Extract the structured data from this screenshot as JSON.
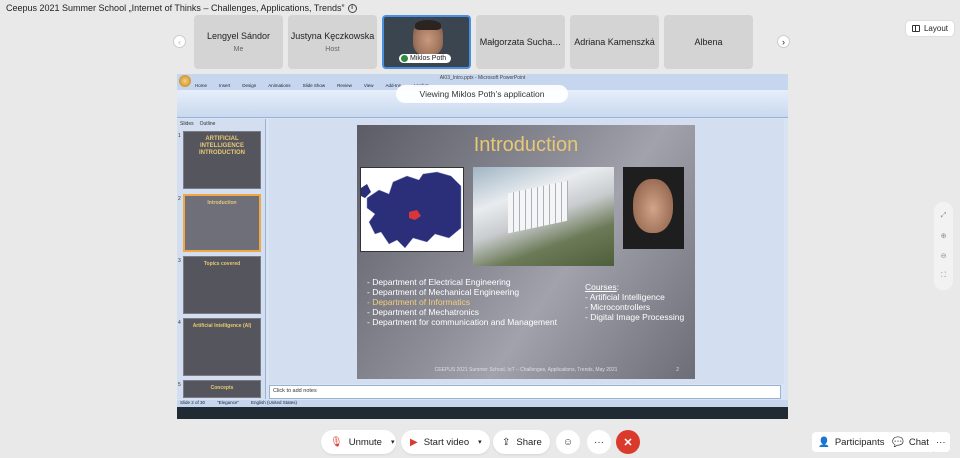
{
  "meeting": {
    "title": "Ceepus 2021 Summer School „Internet of Thinks – Challenges, Applications, Trends”",
    "layout_label": "Layout"
  },
  "participants": [
    {
      "name": "Lengyel Sándor",
      "role": "Me",
      "video": false
    },
    {
      "name": "Justyna Kęczkowska",
      "role": "Host",
      "video": false
    },
    {
      "name": "Miklos Poth",
      "role": "",
      "video": true
    },
    {
      "name": "Małgorzata Sucha…",
      "role": "",
      "video": false
    },
    {
      "name": "Adriana Kamenszká",
      "role": "",
      "video": false
    },
    {
      "name": "Albena",
      "role": "",
      "video": false
    }
  ],
  "share": {
    "viewing_label": "Viewing Miklos Poth’s application",
    "app_title": "AI03_Intro.pptx - Microsoft PowerPoint",
    "ribbon_tabs": [
      "Home",
      "Insert",
      "Design",
      "Animations",
      "Slide Show",
      "Review",
      "View",
      "Add-Ins",
      "Acrobat"
    ],
    "pane_tabs": [
      "Slides",
      "Outline"
    ],
    "thumbnails": [
      {
        "num": "1",
        "title": "ARTIFICIAL INTELLIGENCE INTRODUCTION"
      },
      {
        "num": "2",
        "title": "Introduction"
      },
      {
        "num": "3",
        "title": "Topics covered"
      },
      {
        "num": "4",
        "title": "Artificial Intelligence (AI)"
      },
      {
        "num": "5",
        "title": "Concepts"
      }
    ],
    "notes_placeholder": "Click to add notes",
    "status_items": [
      "Slide 2 of 30",
      "\"Elegance\"",
      "English (United States)"
    ]
  },
  "slide": {
    "title": "Introduction",
    "departments": [
      "- Department of Electrical Engineering",
      "- Department of Mechanical Engineering",
      "- Department of Informatics",
      "- Department of Mechatronics",
      "- Department for communication and Management"
    ],
    "courses_heading": "Courses",
    "courses_colon": ":",
    "courses": [
      "- Artificial Intelligence",
      "- Microcontrollers",
      "- Digital Image Processing"
    ],
    "footer": "CEEPUS 2021 Summer School, IoT – Challenges, Applications, Trends, May 2021",
    "number": "2",
    "colors": {
      "title": "#e8c873",
      "highlight": "#f5cf79",
      "map_country": "#2b2f7a"
    }
  },
  "toolbar": {
    "unmute_label": "Unmute",
    "start_video_label": "Start video",
    "share_label": "Share",
    "participants_label": "Participants",
    "chat_label": "Chat",
    "accent_end_call": "#d93a2b"
  }
}
